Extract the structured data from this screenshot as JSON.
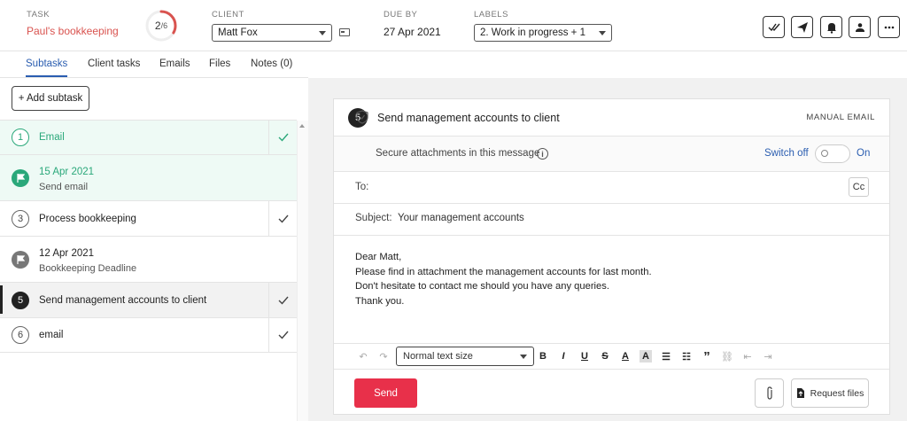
{
  "header": {
    "task_label": "TASK",
    "task_title": "Paul's bookkeeping",
    "progress_done": "2",
    "progress_total": "/6",
    "progress_fraction": 0.333,
    "client_label": "CLIENT",
    "client_value": "Matt Fox",
    "due_label": "DUE BY",
    "due_value": "27 Apr 2021",
    "labels_label": "LABELS",
    "labels_value": "2. Work in progress + 1",
    "actions": [
      "double-check-icon",
      "send-icon",
      "bell-icon",
      "assign-user-icon",
      "more-icon"
    ],
    "accent_color": "#d9534f"
  },
  "tabs": [
    {
      "label": "Subtasks",
      "active": true
    },
    {
      "label": "Client tasks",
      "active": false
    },
    {
      "label": "Emails",
      "active": false
    },
    {
      "label": "Files",
      "active": false
    },
    {
      "label": "Notes (0)",
      "active": false
    }
  ],
  "left": {
    "add_label": "+ Add subtask",
    "items": [
      {
        "num": "1",
        "title": "Email",
        "checked": true
      },
      {
        "date": "15 Apr 2021",
        "sub": "Send email"
      },
      {
        "num": "3",
        "title": "Process bookkeeping",
        "checked": true
      },
      {
        "date": "12 Apr 2021",
        "sub": "Bookkeeping Deadline"
      },
      {
        "num": "5",
        "title": "Send management accounts to client",
        "checked": true
      },
      {
        "num": "6",
        "title": "email",
        "checked": true
      }
    ]
  },
  "email": {
    "num": "5",
    "title": "Send management accounts to client",
    "type": "MANUAL EMAIL",
    "secure_text": "Secure attachments in this message",
    "switch_off": "Switch off",
    "on_label": "On",
    "to_label": "To:",
    "cc_label": "Cc",
    "subject_label": "Subject:",
    "subject_value": "Your management accounts",
    "body": [
      "Dear Matt,",
      "Please find in attachment the management accounts for last month.",
      "Don't hesitate to contact me should you have any queries.",
      "Thank you."
    ],
    "text_size": "Normal text size",
    "send_label": "Send",
    "request_label": "Request files",
    "send_color": "#e8304a"
  }
}
